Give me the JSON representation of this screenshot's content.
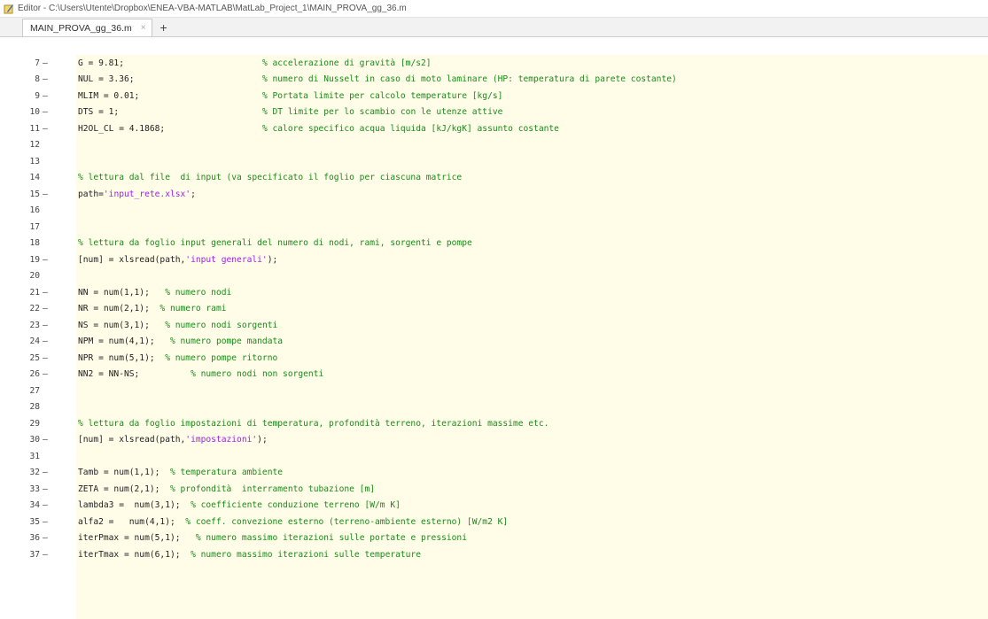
{
  "window": {
    "title": "Editor - C:\\Users\\Utente\\Dropbox\\ENEA-VBA-MATLAB\\MatLab_Project_1\\MAIN_PROVA_gg_36.m"
  },
  "tabs": [
    {
      "label": "MAIN_PROVA_gg_36.m",
      "close": "×"
    }
  ],
  "tab_add_label": "+",
  "lines": [
    {
      "n": "7",
      "dash": "–",
      "parts": [
        [
          "code",
          "G = 9.81;                           "
        ],
        [
          "cmt",
          "% accelerazione di gravità [m/s2]"
        ]
      ]
    },
    {
      "n": "8",
      "dash": "–",
      "parts": [
        [
          "code",
          "NUL = 3.36;                         "
        ],
        [
          "cmt",
          "% numero di Nusselt in caso di moto laminare (HP: temperatura di parete costante)"
        ]
      ]
    },
    {
      "n": "9",
      "dash": "–",
      "parts": [
        [
          "code",
          "MLIM = 0.01;                        "
        ],
        [
          "cmt",
          "% Portata limite per calcolo temperature [kg/s]"
        ]
      ]
    },
    {
      "n": "10",
      "dash": "–",
      "parts": [
        [
          "code",
          "DTS = 1;                            "
        ],
        [
          "cmt",
          "% DT limite per lo scambio con le utenze attive"
        ]
      ]
    },
    {
      "n": "11",
      "dash": "–",
      "parts": [
        [
          "code",
          "H2OL_CL = 4.1868;                   "
        ],
        [
          "cmt",
          "% calore specifico acqua liquida [kJ/kgK] assunto costante"
        ]
      ]
    },
    {
      "n": "12",
      "dash": "",
      "parts": []
    },
    {
      "n": "13",
      "dash": "",
      "parts": []
    },
    {
      "n": "14",
      "dash": "",
      "parts": [
        [
          "cmt",
          "% lettura dal file  di input (va specificato il foglio per ciascuna matrice"
        ]
      ]
    },
    {
      "n": "15",
      "dash": "–",
      "parts": [
        [
          "code",
          "path="
        ],
        [
          "str",
          "'input_rete.xlsx'"
        ],
        [
          "code",
          ";"
        ]
      ]
    },
    {
      "n": "16",
      "dash": "",
      "parts": []
    },
    {
      "n": "17",
      "dash": "",
      "parts": []
    },
    {
      "n": "18",
      "dash": "",
      "parts": [
        [
          "cmt",
          "% lettura da foglio input generali del numero di nodi, rami, sorgenti e pompe"
        ]
      ]
    },
    {
      "n": "19",
      "dash": "–",
      "parts": [
        [
          "code",
          "[num] = xlsread(path,"
        ],
        [
          "str",
          "'input generali'"
        ],
        [
          "code",
          ");"
        ]
      ]
    },
    {
      "n": "20",
      "dash": "",
      "parts": []
    },
    {
      "n": "21",
      "dash": "–",
      "parts": [
        [
          "code",
          "NN = num(1,1);   "
        ],
        [
          "cmt",
          "% numero nodi"
        ]
      ]
    },
    {
      "n": "22",
      "dash": "–",
      "parts": [
        [
          "code",
          "NR = num(2,1);  "
        ],
        [
          "cmt",
          "% numero rami"
        ]
      ]
    },
    {
      "n": "23",
      "dash": "–",
      "parts": [
        [
          "code",
          "NS = num(3,1);   "
        ],
        [
          "cmt",
          "% numero nodi sorgenti"
        ]
      ]
    },
    {
      "n": "24",
      "dash": "–",
      "parts": [
        [
          "code",
          "NPM = num(4,1);   "
        ],
        [
          "cmt",
          "% numero pompe mandata"
        ]
      ]
    },
    {
      "n": "25",
      "dash": "–",
      "parts": [
        [
          "code",
          "NPR = num(5,1);  "
        ],
        [
          "cmt",
          "% numero pompe ritorno"
        ]
      ]
    },
    {
      "n": "26",
      "dash": "–",
      "parts": [
        [
          "code",
          "NN2 = NN-NS;          "
        ],
        [
          "cmt",
          "% numero nodi non sorgenti"
        ]
      ]
    },
    {
      "n": "27",
      "dash": "",
      "parts": []
    },
    {
      "n": "28",
      "dash": "",
      "parts": []
    },
    {
      "n": "29",
      "dash": "",
      "parts": [
        [
          "cmt",
          "% lettura da foglio impostazioni di temperatura, profondità terreno, iterazioni massime etc."
        ]
      ]
    },
    {
      "n": "30",
      "dash": "–",
      "parts": [
        [
          "code",
          "[num] = xlsread(path,"
        ],
        [
          "str",
          "'impostazioni'"
        ],
        [
          "code",
          ");"
        ]
      ]
    },
    {
      "n": "31",
      "dash": "",
      "parts": []
    },
    {
      "n": "32",
      "dash": "–",
      "parts": [
        [
          "code",
          "Tamb = num(1,1);  "
        ],
        [
          "cmt",
          "% temperatura ambiente"
        ]
      ]
    },
    {
      "n": "33",
      "dash": "–",
      "parts": [
        [
          "code",
          "ZETA = num(2,1);  "
        ],
        [
          "cmt",
          "% profondità  interramento tubazione [m]"
        ]
      ]
    },
    {
      "n": "34",
      "dash": "–",
      "parts": [
        [
          "code",
          "lambda3 =  num(3,1);  "
        ],
        [
          "cmt",
          "% coefficiente conduzione terreno [W/m K]"
        ]
      ]
    },
    {
      "n": "35",
      "dash": "–",
      "parts": [
        [
          "code",
          "alfa2 =   num(4,1);  "
        ],
        [
          "cmt",
          "% coeff. convezione esterno (terreno-ambiente esterno) [W/m2 K]"
        ]
      ]
    },
    {
      "n": "36",
      "dash": "–",
      "parts": [
        [
          "code",
          "iterPmax = num(5,1);   "
        ],
        [
          "cmt",
          "% numero massimo iterazioni sulle portate e pressioni"
        ]
      ]
    },
    {
      "n": "37",
      "dash": "–",
      "parts": [
        [
          "code",
          "iterTmax = num(6,1);  "
        ],
        [
          "cmt",
          "% numero massimo iterazioni sulle temperature"
        ]
      ]
    }
  ]
}
